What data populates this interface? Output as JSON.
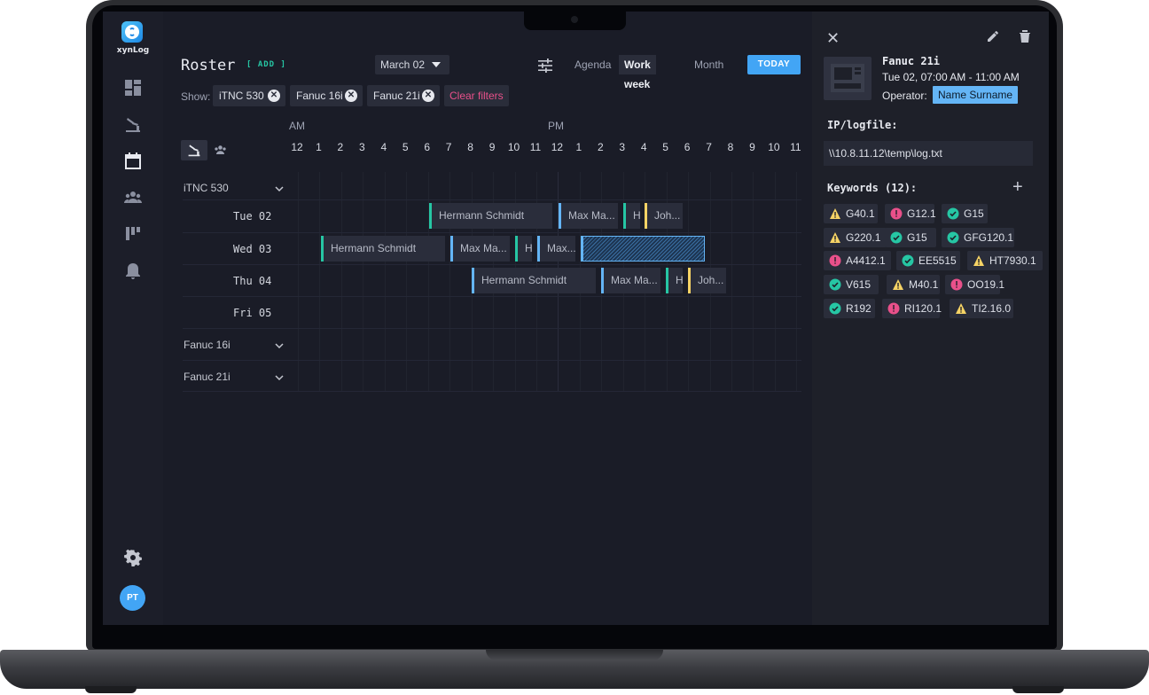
{
  "app": {
    "name": "xynLog",
    "user_initials": "PT"
  },
  "sidebar": {
    "items": [
      {
        "name": "dashboard-icon"
      },
      {
        "name": "machine-icon"
      },
      {
        "name": "calendar-icon"
      },
      {
        "name": "people-icon"
      },
      {
        "name": "board-icon"
      },
      {
        "name": "bell-icon"
      },
      {
        "name": "gear-icon"
      }
    ]
  },
  "header": {
    "title": "Roster",
    "add_label": "[ ADD ]",
    "date_value": "March 02",
    "views": [
      "Agenda",
      "Work week",
      "Month"
    ],
    "active_view": "Work week",
    "today_label": "TODAY"
  },
  "filters": {
    "show_label": "Show:",
    "chips": [
      "iTNC 530",
      "Fanuc 16i",
      "Fanuc 21i"
    ],
    "clear_label": "Clear filters"
  },
  "timeline": {
    "am_label": "AM",
    "pm_label": "PM",
    "hours": [
      "12",
      "1",
      "2",
      "3",
      "4",
      "5",
      "6",
      "7",
      "8",
      "9",
      "10",
      "11",
      "12",
      "1",
      "2",
      "3",
      "4",
      "5",
      "6",
      "7",
      "8",
      "9",
      "10",
      "11"
    ],
    "groups": [
      {
        "label": "iTNC 530",
        "expanded": true,
        "days": [
          "Tue 02",
          "Wed 03",
          "Thu 04",
          "Fri 05"
        ]
      },
      {
        "label": "Fanuc 16i",
        "expanded": false
      },
      {
        "label": "Fanuc 21i",
        "expanded": false
      }
    ],
    "events": {
      "row0": [
        "Hermann Schmidt",
        "Max Ma...",
        "H",
        "Joh..."
      ],
      "row1": [
        "Hermann Schmidt",
        "Max Ma...",
        "H",
        "Max..."
      ],
      "row2": [
        "Hermann Schmidt",
        "Max Ma...",
        "H",
        "Joh..."
      ]
    }
  },
  "panel": {
    "machine": "Fanuc 21i",
    "time": "Tue 02, 07:00 AM - 11:00 AM",
    "operator_label": "Operator:",
    "operator": "Name Surname",
    "ip_label": "IP/logfile:",
    "ip_value": "\\\\10.8.11.12\\temp\\log.txt",
    "keywords_label": "Keywords (12):",
    "keywords": [
      {
        "text": "G40.1",
        "status": "warning"
      },
      {
        "text": "G12.1",
        "status": "error"
      },
      {
        "text": "G15",
        "status": "ok"
      },
      {
        "text": "G220.1",
        "status": "warning"
      },
      {
        "text": "G15",
        "status": "ok"
      },
      {
        "text": "GFG120.1",
        "status": "ok"
      },
      {
        "text": "A4412.1",
        "status": "error"
      },
      {
        "text": "EE5515",
        "status": "ok"
      },
      {
        "text": "HT7930.1",
        "status": "warning"
      },
      {
        "text": "V615",
        "status": "ok"
      },
      {
        "text": "M40.1",
        "status": "warning"
      },
      {
        "text": "OO19.1",
        "status": "error"
      },
      {
        "text": "R192",
        "status": "ok"
      },
      {
        "text": "RI120.1",
        "status": "error"
      },
      {
        "text": "TI2.16.0",
        "status": "warning"
      }
    ]
  },
  "colors": {
    "accent": "#42a5f5",
    "teal": "#26c6a4",
    "warning": "#f6d365",
    "error": "#e9508a",
    "ok": "#26c6a4"
  }
}
